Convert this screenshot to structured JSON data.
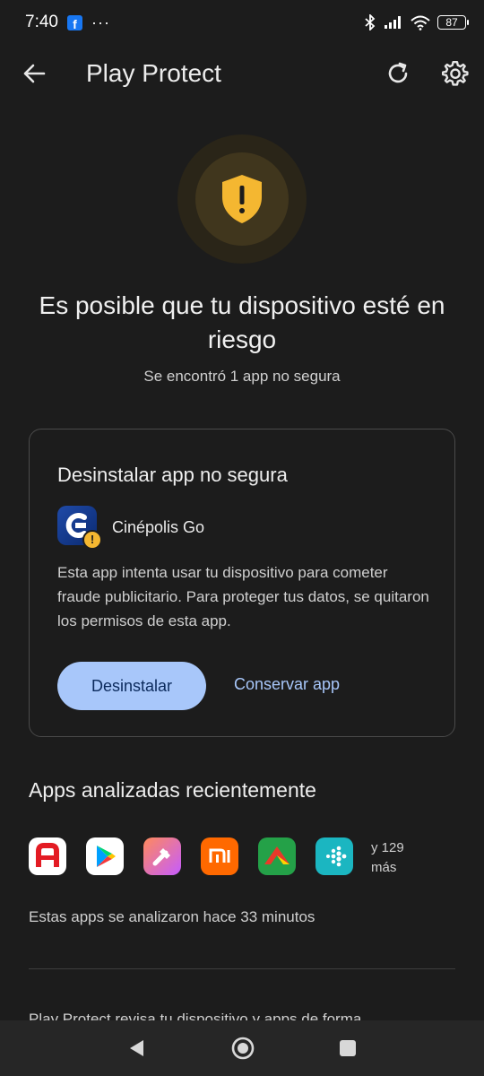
{
  "status_bar": {
    "time": "7:40",
    "fb_letter": "f",
    "more_dots": "···",
    "battery": "87"
  },
  "app_bar": {
    "title": "Play Protect"
  },
  "hero": {
    "headline": "Es posible que tu dispositivo esté en riesgo",
    "subhead": "Se encontró 1 app no segura"
  },
  "card": {
    "title": "Desinstalar app no segura",
    "app_name": "Cinépolis Go",
    "description": "Esta app intenta usar tu dispositivo para cometer fraude publicitario. Para proteger tus datos, se quitaron los permisos de esta app.",
    "primary_button": "Desinstalar",
    "secondary_button": "Conservar app"
  },
  "recent": {
    "title": "Apps analizadas recientemente",
    "more_line1": "y 129",
    "more_line2": "más",
    "scan_time": "Estas apps se analizaron hace 33 minutos"
  },
  "footer": {
    "text": "Play Protect revisa tu dispositivo y apps de forma"
  },
  "colors": {
    "background": "#1c1c1c",
    "accent": "#a8c7fa",
    "warning": "#f4b731"
  }
}
